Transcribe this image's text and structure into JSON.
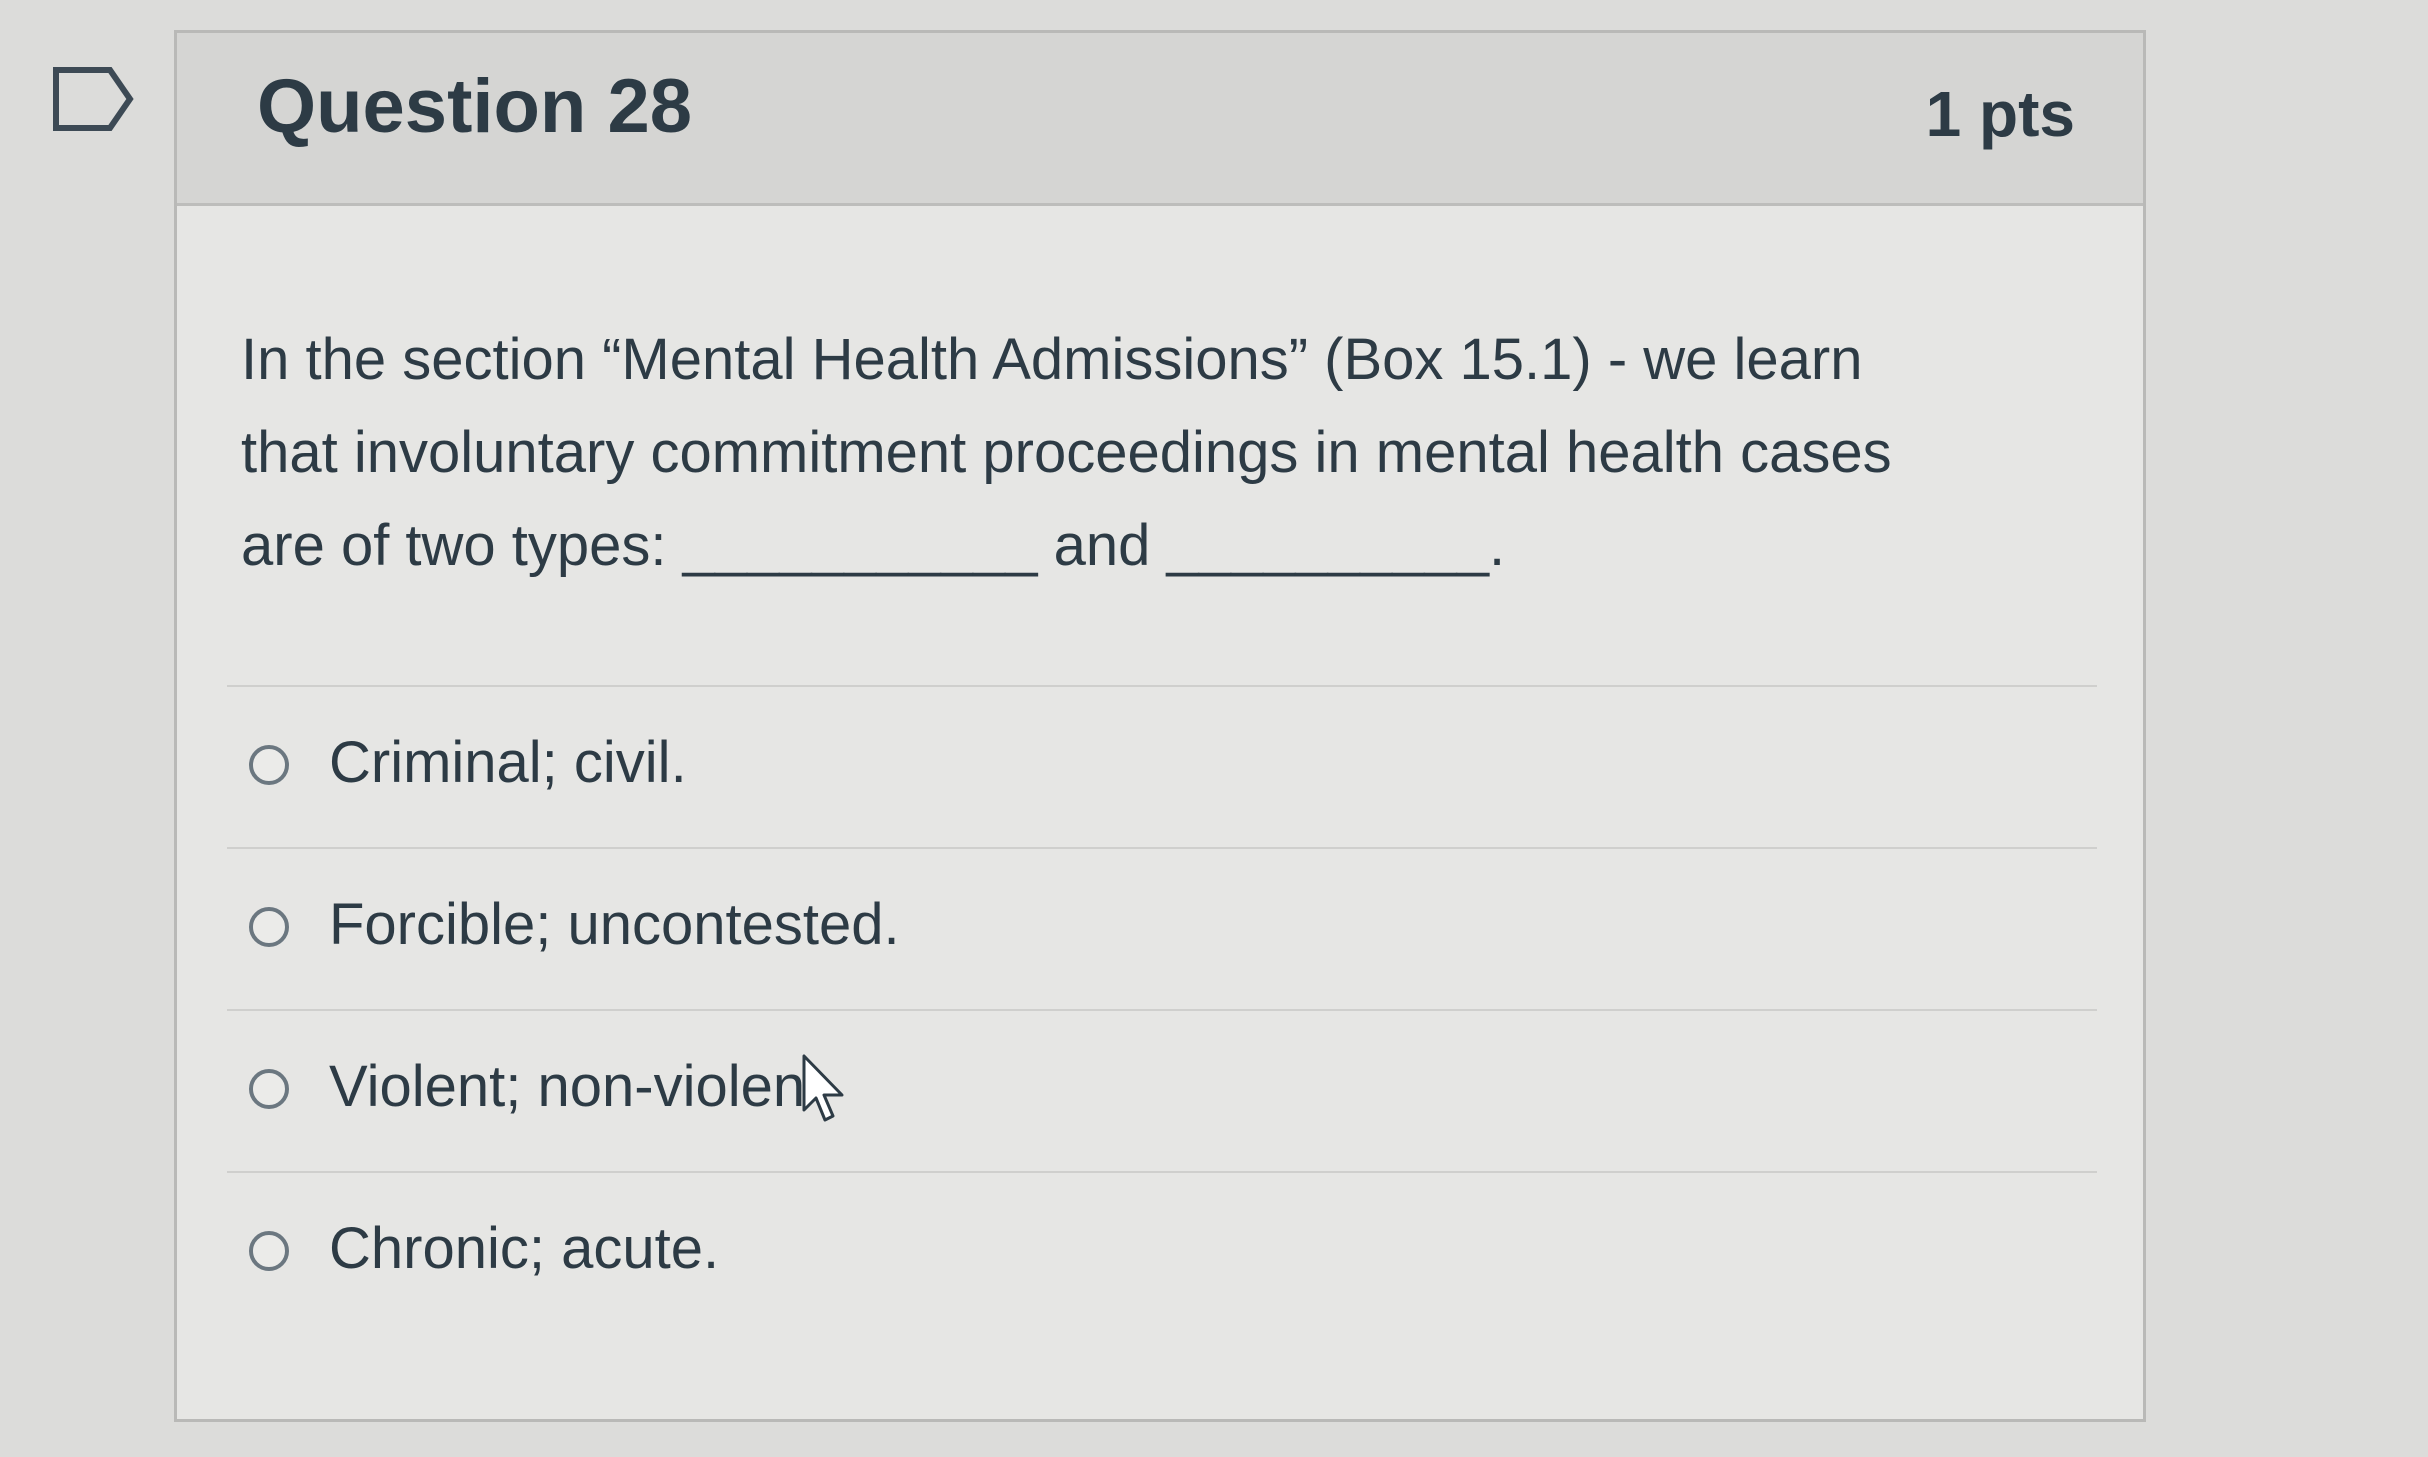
{
  "question": {
    "title": "Question 28",
    "points": "1 pts",
    "text_line1": "In the section “Mental Health Admissions” (Box 15.1) - we learn",
    "text_line2": "that involuntary commitment proceedings in mental health cases",
    "text_line3": "are of two types: ___________ and __________."
  },
  "answers": [
    {
      "label": "Criminal; civil."
    },
    {
      "label": "Forcible; uncontested."
    },
    {
      "label": "Violent; non-violen"
    },
    {
      "label": "Chronic; acute."
    }
  ],
  "icons": {
    "flag": "flag-question-icon",
    "cursor": "mouse-pointer-icon"
  },
  "colors": {
    "text": "#2d3b45",
    "header_bg": "#d5d5d3",
    "card_bg": "#e6e6e4"
  }
}
